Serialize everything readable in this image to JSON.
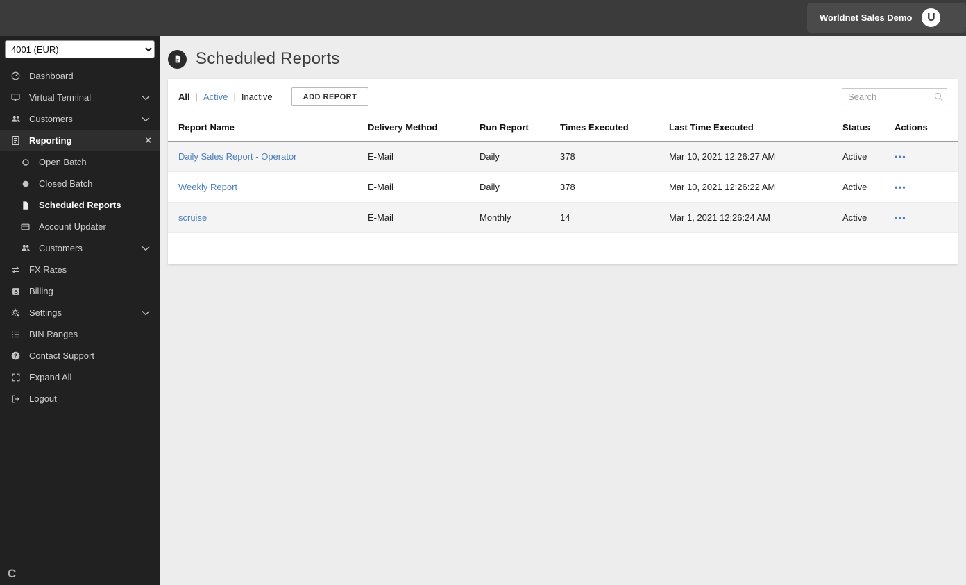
{
  "colors": {
    "accent_link": "#4d7fbe",
    "sidebar_bg": "#212121",
    "topbar_bg": "#3b3b3b",
    "content_bg": "#ededed"
  },
  "topbar": {
    "user_label": "Worldnet Sales Demo",
    "avatar_initial": "U"
  },
  "sidebar": {
    "terminal_select": "4001 (EUR)",
    "close_glyph": "×",
    "logo": "C",
    "items": [
      {
        "label": "Dashboard"
      },
      {
        "label": "Virtual Terminal"
      },
      {
        "label": "Customers"
      },
      {
        "label": "Reporting"
      },
      {
        "label": "Open Batch"
      },
      {
        "label": "Closed Batch"
      },
      {
        "label": "Scheduled Reports"
      },
      {
        "label": "Account Updater"
      },
      {
        "label": "Customers"
      },
      {
        "label": "FX Rates"
      },
      {
        "label": "Billing"
      },
      {
        "label": "Settings"
      },
      {
        "label": "BIN Ranges"
      },
      {
        "label": "Contact Support"
      },
      {
        "label": "Expand All"
      },
      {
        "label": "Logout"
      }
    ]
  },
  "main": {
    "title": "Scheduled Reports",
    "filters": {
      "all": "All",
      "active": "Active",
      "inactive": "Inactive",
      "separator": "|"
    },
    "add_button_label": "ADD REPORT",
    "search_placeholder": "Search",
    "table": {
      "columns": [
        "Report Name",
        "Delivery Method",
        "Run Report",
        "Times Executed",
        "Last Time Executed",
        "Status",
        "Actions"
      ],
      "rows": [
        {
          "name": "Daily Sales Report - Operator",
          "delivery_method": "E-Mail",
          "run_report": "Daily",
          "times_executed": "378",
          "last_executed": "Mar 10, 2021 12:26:27 AM",
          "status": "Active",
          "actions": "•••"
        },
        {
          "name": "Weekly Report",
          "delivery_method": "E-Mail",
          "run_report": "Daily",
          "times_executed": "378",
          "last_executed": "Mar 10, 2021 12:26:22 AM",
          "status": "Active",
          "actions": "•••"
        },
        {
          "name": "scruise",
          "delivery_method": "E-Mail",
          "run_report": "Monthly",
          "times_executed": "14",
          "last_executed": "Mar 1, 2021 12:26:24 AM",
          "status": "Active",
          "actions": "•••"
        }
      ]
    }
  }
}
